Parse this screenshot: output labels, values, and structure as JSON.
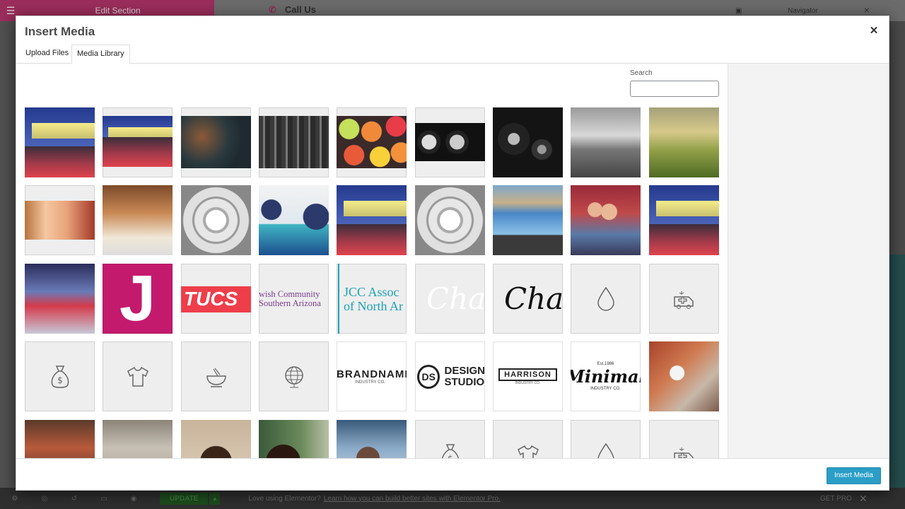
{
  "background": {
    "editor_title": "Edit Section",
    "call_us": "Call Us",
    "navigator": "Navigator",
    "update_label": "UPDATE",
    "promo_text": "Love using Elementor?",
    "promo_link": "Learn how you can build better sites with Elementor Pro.",
    "get_pro": "GET PRO"
  },
  "modal": {
    "title": "Insert Media",
    "tabs": [
      "Upload Files",
      "Media Library"
    ],
    "search_label": "Search",
    "search_value": "",
    "insert_button": "Insert Media"
  },
  "thumb_text": {
    "t_tucson": "TUCS",
    "t_jcc_community": "wish Community\nSouthern Arizona",
    "t_jcc_assoc": "JCC Assoc\nof North Ar",
    "t_charm": "Charm",
    "t_charm_dark": "Charm",
    "t_j": "J",
    "t_brandname": "BRANDNAME",
    "t_brandname_sub": "INDUSTRY CO.",
    "t_design": "DESIGN\nSTUDIO",
    "t_ds": "DS",
    "t_harrison": "HARRISON",
    "t_harrison_sub": "INDUSTRY CO.",
    "t_minimal": "Minimal",
    "t_minimal_est": "Est.1986",
    "t_minimal_sub": "INDUSTRY CO."
  },
  "library_items": [
    {
      "name": "building-night",
      "icon": ""
    },
    {
      "name": "building-night-2",
      "icon": ""
    },
    {
      "name": "food-dark",
      "icon": ""
    },
    {
      "name": "gym-interior",
      "icon": ""
    },
    {
      "name": "citrus-fruits",
      "icon": ""
    },
    {
      "name": "barbell-bw",
      "icon": ""
    },
    {
      "name": "weights-bw",
      "icon": ""
    },
    {
      "name": "desert-bw",
      "icon": ""
    },
    {
      "name": "desert-color",
      "icon": ""
    },
    {
      "name": "women-talking",
      "icon": ""
    },
    {
      "name": "women-meeting",
      "icon": ""
    },
    {
      "name": "gym-machine",
      "icon": ""
    },
    {
      "name": "bench-press",
      "icon": ""
    },
    {
      "name": "building-night-3",
      "icon": ""
    },
    {
      "name": "gym-machine-2",
      "icon": ""
    },
    {
      "name": "swimming-pool",
      "icon": ""
    },
    {
      "name": "kids",
      "icon": ""
    },
    {
      "name": "building-night-4",
      "icon": ""
    },
    {
      "name": "dance-class",
      "icon": ""
    },
    {
      "name": "j-logo",
      "icon": ""
    },
    {
      "name": "tucson-logo",
      "icon": ""
    },
    {
      "name": "jcc-community-logo",
      "icon": ""
    },
    {
      "name": "jcc-association-logo",
      "icon": ""
    },
    {
      "name": "charm-white",
      "icon": ""
    },
    {
      "name": "charm-black",
      "icon": ""
    },
    {
      "name": "drop",
      "icon": "drop-icon"
    },
    {
      "name": "ambulance",
      "icon": "ambulance-icon"
    },
    {
      "name": "money-bag",
      "icon": "money-bag-icon"
    },
    {
      "name": "t-shirt",
      "icon": "tshirt-icon"
    },
    {
      "name": "bowl",
      "icon": "bowl-icon"
    },
    {
      "name": "globe",
      "icon": "globe-icon"
    },
    {
      "name": "brandname-logo",
      "icon": ""
    },
    {
      "name": "design-studio-logo",
      "icon": ""
    },
    {
      "name": "harrison-logo",
      "icon": ""
    },
    {
      "name": "minimal-logo",
      "icon": ""
    },
    {
      "name": "food-serving",
      "icon": ""
    },
    {
      "name": "market",
      "icon": ""
    },
    {
      "name": "elder",
      "icon": ""
    },
    {
      "name": "child",
      "icon": ""
    },
    {
      "name": "child-water",
      "icon": ""
    },
    {
      "name": "child-blanket",
      "icon": ""
    },
    {
      "name": "money-bag-2",
      "icon": "money-bag-icon"
    },
    {
      "name": "t-shirt-2",
      "icon": "tshirt-icon"
    },
    {
      "name": "drop-2",
      "icon": "drop-icon"
    },
    {
      "name": "ambulance-2",
      "icon": "ambulance-icon"
    }
  ],
  "colors": {
    "accent": "#2a9ec6",
    "elementor_pink": "#9a2d5b",
    "j_logo": "#c41a6e",
    "tucson_red": "#ee3e4b",
    "jcc_purple": "#7d3c8f",
    "jcc_teal": "#1ba1b4"
  }
}
